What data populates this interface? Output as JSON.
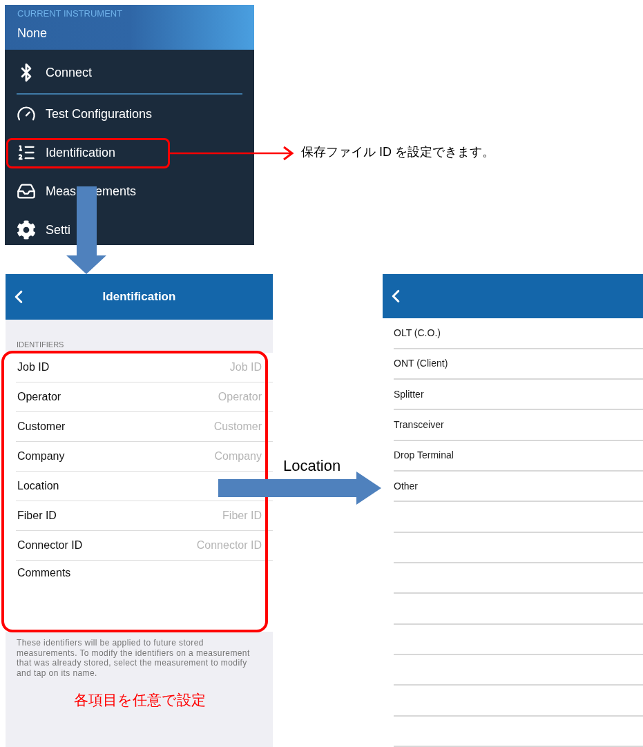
{
  "menu": {
    "header": {
      "label": "CURRENT INSTRUMENT",
      "value": "None"
    },
    "items": [
      {
        "kind": "bluetooth",
        "label": "Connect",
        "divider_after": true
      },
      {
        "kind": "config",
        "label": "Test Configurations",
        "divider_after": false
      },
      {
        "kind": "id",
        "label": "Identification",
        "divider_after": false
      },
      {
        "kind": "measure",
        "label": "Meas",
        "label_after": "ements",
        "divider_after": false
      },
      {
        "kind": "settings",
        "label": "Setti",
        "divider_after": false
      }
    ]
  },
  "identification": {
    "title": "Identification",
    "section": "IDENTIFIERS",
    "fields": [
      {
        "kind": "text",
        "label": "Job ID",
        "placeholder": "Job ID"
      },
      {
        "kind": "text",
        "label": "Operator",
        "placeholder": "Operator"
      },
      {
        "kind": "text",
        "label": "Customer",
        "placeholder": "Customer"
      },
      {
        "kind": "text",
        "label": "Company",
        "placeholder": "Company"
      },
      {
        "kind": "text",
        "label": "Location"
      },
      {
        "kind": "text",
        "label": "Fiber ID",
        "placeholder": "Fiber ID"
      },
      {
        "kind": "text",
        "label": "Connector ID",
        "placeholder": "Connector ID"
      },
      {
        "kind": "multiline",
        "label": "Comments"
      }
    ],
    "footer": "These identifiers will be applied to future stored measurements. To modify the identifiers on a measurement that was already stored, select the measurement to modify and tap on its name."
  },
  "location_picker": {
    "options": [
      "OLT (C.O.)",
      "ONT (Client)",
      "Splitter",
      "Transceiver",
      "Drop Terminal",
      "Other"
    ]
  },
  "annotations": {
    "menu_note": "保存ファイル ID を設定できます。",
    "location_note": "Location",
    "fields_note": "各項目を任意で設定"
  }
}
